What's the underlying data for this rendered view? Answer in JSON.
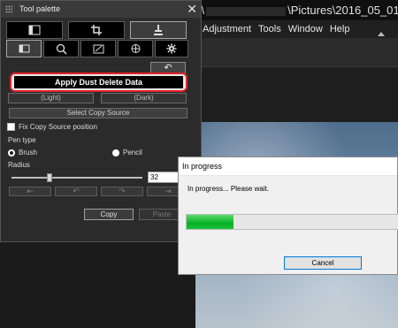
{
  "app": {
    "title_prefix": "s\\",
    "title_suffix": "\\Pictures\\2016_05_01]",
    "menu": [
      "Adjustment",
      "Tools",
      "Window",
      "Help"
    ]
  },
  "palette": {
    "title": "Tool palette",
    "close": "✕",
    "tabs_top": [
      "tone-adjust-icon",
      "crop-icon",
      "stamp-icon"
    ],
    "tabs_bottom": [
      "image-adjust-icon",
      "lens-icon",
      "edit-icon",
      "color-icon",
      "gear-icon"
    ],
    "undo_label": "↶",
    "apply_label": "Apply Dust Delete Data",
    "light_label": "(Light)",
    "dark_label": "(Dark)",
    "select_copy_label": "Select Copy Source",
    "fix_copy_label": "Fix Copy Source position",
    "pen_type_label": "Pen type",
    "brush_label": "Brush",
    "pencil_label": "Pencil",
    "radius_label": "Radius",
    "radius_value": "32",
    "radius_fraction": 0.29,
    "copy_label": "Copy",
    "paste_label": "Paste"
  },
  "dialog": {
    "title": "In progress",
    "message": "In progress... Please wait.",
    "progress": 0.22,
    "cancel_label": "Cancel"
  },
  "colors": {
    "highlight": "#e2232a",
    "progress_green": "#06b025",
    "cancel_border": "#0078d7"
  }
}
